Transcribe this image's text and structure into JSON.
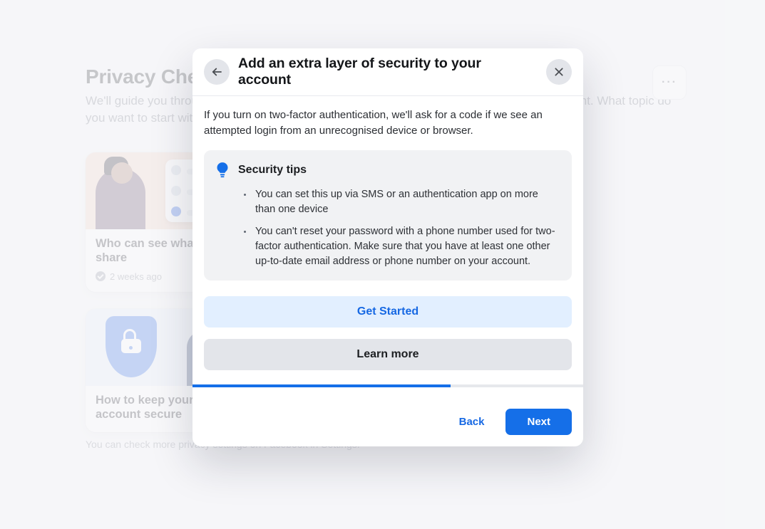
{
  "background": {
    "page_title": "Privacy Checkup",
    "page_subtitle": "We'll guide you through some settings so that you can make the right choices for your account. What topic do you want to start with?",
    "bottom_note": "You can check more privacy settings on Facebook in Settings.",
    "cards": [
      {
        "title": "Who can see what you share",
        "meta": "2 weeks ago"
      },
      {
        "title": "How to keep your account secure",
        "meta": ""
      }
    ]
  },
  "modal": {
    "title": "Add an extra layer of security to your account",
    "description": "If you turn on two-factor authentication, we'll ask for a code if we see an attempted login from an unrecognised device or browser.",
    "tips_title": "Security tips",
    "tips": [
      "You can set this up via SMS or an authentication app on more than one device",
      "You can't reset your password with a phone number used for two-factor authentication. Make sure that you have at least one other up-to-date email address or phone number on your account."
    ],
    "get_started": "Get Started",
    "learn_more": "Learn more",
    "progress_percent": 66,
    "back": "Back",
    "next": "Next"
  }
}
